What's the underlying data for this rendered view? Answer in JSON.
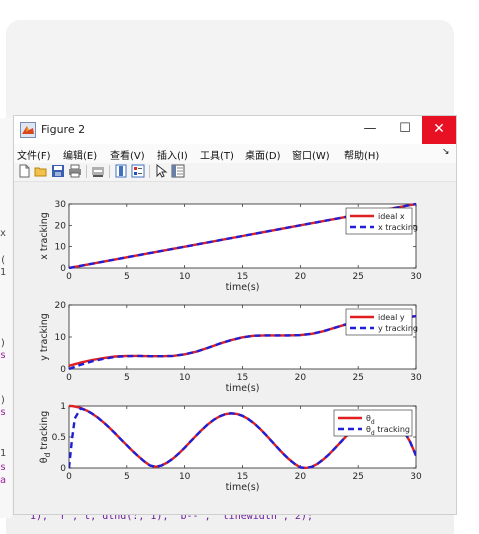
{
  "window": {
    "title": "Figure 2",
    "minimize_glyph": "—",
    "maximize_glyph": "☐",
    "close_glyph": "✕"
  },
  "menus": [
    "文件(F)",
    "编辑(E)",
    "查看(V)",
    "插入(I)",
    "工具(T)",
    "桌面(D)",
    "窗口(W)",
    "帮助(H)"
  ],
  "menu_overflow_glyph": "↘",
  "toolbar": {
    "icons": [
      "new-figure-icon",
      "open-file-icon",
      "save-icon",
      "print-icon",
      "print-preview-icon",
      "colorbar-icon",
      "legend-icon",
      "edit-plot-arrow-icon",
      "property-inspector-icon"
    ]
  },
  "background_code": {
    "fragments": [
      "x",
      "(",
      "1",
      ")",
      "s",
      ")",
      "s",
      "1",
      "s",
      "a"
    ],
    "bottom_line": "1), 'r', t, dthd(:, 1), 'b--', 'linewidth', 2);"
  },
  "colors": {
    "ideal": "#e02020",
    "tracking": "#1f1fd6",
    "close_button": "#e81123"
  },
  "chart_data": [
    {
      "type": "line",
      "xlabel": "time(s)",
      "ylabel": "x tracking",
      "xlim": [
        0,
        30
      ],
      "ylim": [
        0,
        30
      ],
      "xticks": [
        0,
        5,
        10,
        15,
        20,
        25,
        30
      ],
      "yticks": [
        0,
        10,
        20,
        30
      ],
      "legend_position": "top-right",
      "grid": false,
      "x": [
        0,
        5,
        10,
        15,
        20,
        25,
        30
      ],
      "series": [
        {
          "name": "ideal x",
          "style": "solid",
          "values": [
            0,
            5,
            10,
            15,
            20,
            25,
            30
          ]
        },
        {
          "name": "x tracking",
          "style": "dashed",
          "values": [
            0,
            5,
            10,
            15,
            20,
            25,
            30
          ]
        }
      ]
    },
    {
      "type": "line",
      "xlabel": "time(s)",
      "ylabel": "y tracking",
      "xlim": [
        0,
        30
      ],
      "ylim": [
        0,
        20
      ],
      "xticks": [
        0,
        5,
        10,
        15,
        20,
        25,
        30
      ],
      "yticks": [
        0,
        10,
        20
      ],
      "legend_position": "top-right",
      "grid": false,
      "x": [
        0,
        0.5,
        1,
        2,
        3,
        4,
        5,
        6,
        7,
        8,
        9,
        10,
        11,
        12,
        13,
        14,
        15,
        16,
        17,
        18,
        19,
        20,
        21,
        22,
        23,
        24,
        25,
        26,
        27,
        28,
        29,
        30
      ],
      "series": [
        {
          "name": "ideal y",
          "style": "solid",
          "values": [
            1,
            1.5,
            2,
            2.8,
            3.4,
            3.9,
            4.1,
            4.1,
            4.0,
            4.0,
            4.1,
            4.6,
            5.4,
            6.6,
            7.9,
            9.0,
            9.9,
            10.4,
            10.5,
            10.5,
            10.5,
            10.6,
            11.0,
            11.8,
            12.9,
            14.0,
            15.0,
            15.7,
            16.0,
            16.0,
            16.1,
            16.5
          ]
        },
        {
          "name": "y tracking",
          "style": "dashed",
          "values": [
            0,
            0.7,
            1.3,
            2.4,
            3.2,
            3.8,
            4.0,
            4.1,
            4.0,
            4.0,
            4.1,
            4.6,
            5.4,
            6.6,
            7.9,
            9.0,
            9.9,
            10.4,
            10.5,
            10.5,
            10.5,
            10.6,
            11.0,
            11.8,
            12.9,
            14.0,
            15.0,
            15.7,
            16.0,
            16.0,
            16.1,
            16.5
          ]
        }
      ]
    },
    {
      "type": "line",
      "xlabel": "time(s)",
      "ylabel": "θd tracking",
      "ylabel_main": "θ",
      "ylabel_sub": "d",
      "ylabel_rest": " tracking",
      "xlim": [
        0,
        30
      ],
      "ylim": [
        0,
        1
      ],
      "xticks": [
        0,
        5,
        10,
        15,
        20,
        25,
        30
      ],
      "yticks": [
        0,
        0.5,
        1
      ],
      "legend_position": "top-right",
      "grid": false,
      "x": [
        0,
        0.25,
        0.5,
        1,
        1.5,
        2,
        2.5,
        3,
        3.5,
        4,
        4.5,
        5,
        5.5,
        6,
        6.5,
        7,
        7.5,
        8,
        8.5,
        9,
        9.5,
        10,
        10.5,
        11,
        11.5,
        12,
        12.5,
        13,
        13.5,
        14,
        14.5,
        15,
        15.5,
        16,
        16.5,
        17,
        17.5,
        18,
        18.5,
        19,
        19.5,
        20,
        20.5,
        21,
        21.5,
        22,
        22.5,
        23,
        23.5,
        24,
        24.5,
        25,
        25.5,
        26,
        26.5,
        27,
        27.5,
        28,
        28.5,
        29,
        29.5,
        30
      ],
      "series": [
        {
          "name": "θd",
          "name_main": "θ",
          "name_sub": "d",
          "name_rest": "",
          "style": "solid",
          "values": [
            1.0,
            0.998,
            0.992,
            0.969,
            0.93,
            0.877,
            0.811,
            0.734,
            0.648,
            0.557,
            0.462,
            0.367,
            0.274,
            0.187,
            0.107,
            0.04,
            0.02,
            0.04,
            0.088,
            0.154,
            0.236,
            0.327,
            0.425,
            0.523,
            0.617,
            0.703,
            0.775,
            0.831,
            0.867,
            0.882,
            0.873,
            0.842,
            0.789,
            0.719,
            0.634,
            0.539,
            0.437,
            0.334,
            0.234,
            0.143,
            0.067,
            0.01,
            0.0,
            0.02,
            0.07,
            0.14,
            0.225,
            0.32,
            0.42,
            0.52,
            0.612,
            0.69,
            0.753,
            0.798,
            0.82,
            0.82,
            0.797,
            0.75,
            0.68,
            0.58,
            0.42,
            0.2
          ]
        },
        {
          "name": "θd tracking",
          "name_main": "θ",
          "name_sub": "d",
          "name_rest": " tracking",
          "style": "dashed",
          "values": [
            0.0,
            0.45,
            0.8,
            0.96,
            0.93,
            0.877,
            0.811,
            0.734,
            0.648,
            0.557,
            0.462,
            0.367,
            0.274,
            0.187,
            0.107,
            0.04,
            0.02,
            0.04,
            0.088,
            0.154,
            0.236,
            0.327,
            0.425,
            0.523,
            0.617,
            0.703,
            0.775,
            0.831,
            0.867,
            0.882,
            0.873,
            0.842,
            0.789,
            0.719,
            0.634,
            0.539,
            0.437,
            0.334,
            0.234,
            0.143,
            0.067,
            0.01,
            0.0,
            0.02,
            0.07,
            0.14,
            0.225,
            0.32,
            0.42,
            0.52,
            0.612,
            0.69,
            0.753,
            0.798,
            0.82,
            0.82,
            0.797,
            0.75,
            0.68,
            0.58,
            0.42,
            0.2
          ]
        }
      ]
    }
  ]
}
